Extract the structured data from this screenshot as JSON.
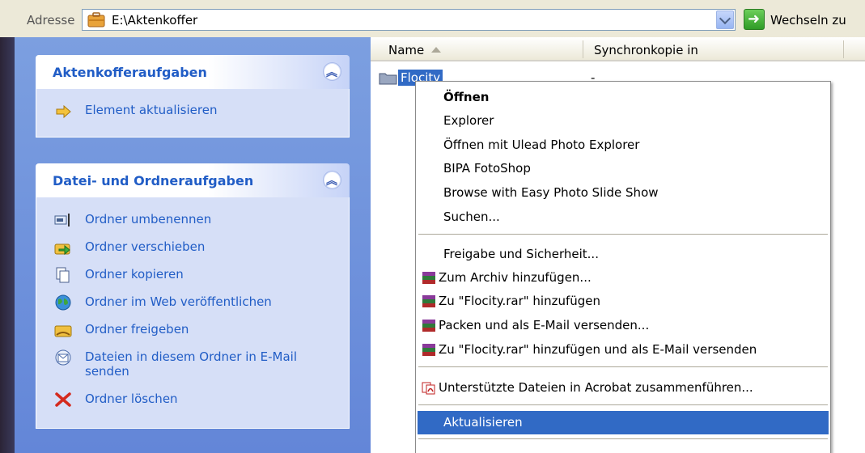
{
  "address_bar": {
    "label": "Adresse",
    "path": "E:\\Aktenkoffer",
    "go_label": "Wechseln zu",
    "folder_icon": "briefcase-folder-icon",
    "go_icon": "green-arrow-icon"
  },
  "task_pane": {
    "briefcase_tasks": {
      "title": "Aktenkofferaufgaben",
      "items": [
        {
          "label": "Element aktualisieren",
          "icon": "update-icon"
        }
      ]
    },
    "file_tasks": {
      "title": "Datei- und Ordneraufgaben",
      "items": [
        {
          "label": "Ordner umbenennen",
          "icon": "rename-icon"
        },
        {
          "label": "Ordner verschieben",
          "icon": "move-icon"
        },
        {
          "label": "Ordner kopieren",
          "icon": "copy-icon"
        },
        {
          "label": "Ordner im Web veröffentlichen",
          "icon": "web-publish-icon"
        },
        {
          "label": "Ordner freigeben",
          "icon": "share-icon"
        },
        {
          "label": "Dateien in diesem Ordner in E-Mail senden",
          "icon": "email-icon"
        },
        {
          "label": "Ordner löschen",
          "icon": "delete-icon"
        }
      ]
    }
  },
  "file_list": {
    "columns": [
      "Name",
      "Synchronkopie in"
    ],
    "rows": [
      {
        "name": "Flocity",
        "sync": "---"
      }
    ]
  },
  "context_menu": {
    "items": [
      {
        "label": "Öffnen",
        "bold": true
      },
      {
        "label": "Explorer"
      },
      {
        "label": "Öffnen mit Ulead Photo Explorer"
      },
      {
        "label": "BIPA FotoShop"
      },
      {
        "label": "Browse with Easy Photo Slide Show"
      },
      {
        "label": "Suchen..."
      },
      {
        "label": "Freigabe und Sicherheit..."
      },
      {
        "label": "Zum Archiv hinzufügen...",
        "icon": "winrar-icon"
      },
      {
        "label": "Zu \"Flocity.rar\" hinzufügen",
        "icon": "winrar-icon"
      },
      {
        "label": "Packen und als E-Mail versenden...",
        "icon": "winrar-icon"
      },
      {
        "label": "Zu \"Flocity.rar\" hinzufügen und als E-Mail versenden",
        "icon": "winrar-icon"
      },
      {
        "label": "Unterstützte Dateien in Acrobat zusammenführen...",
        "icon": "acrobat-icon"
      },
      {
        "label": "Aktualisieren",
        "highlighted": true
      }
    ]
  },
  "colors": {
    "selection": "#316ac5",
    "task_link": "#215dc6",
    "pane_background": "#6f92dc"
  }
}
